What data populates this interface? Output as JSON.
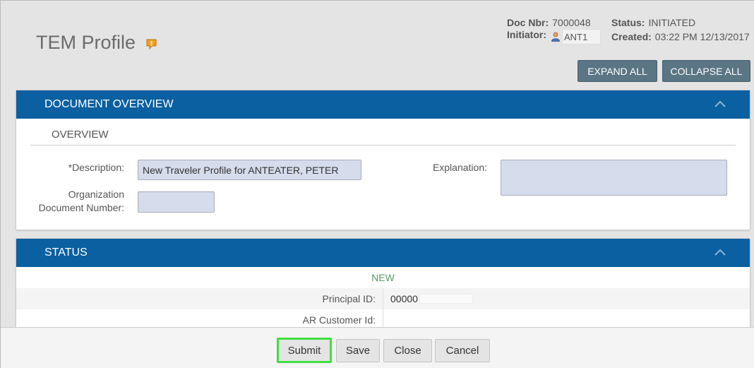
{
  "header": {
    "title": "TEM Profile",
    "doc_nbr_label": "Doc Nbr:",
    "doc_nbr": "7000048",
    "status_label": "Status:",
    "status": "INITIATED",
    "initiator_label": "Initiator:",
    "initiator": "ANT1",
    "created_label": "Created:",
    "created": "03:22 PM 12/13/2017"
  },
  "toolbar": {
    "expand_all": "EXPAND ALL",
    "collapse_all": "COLLAPSE ALL"
  },
  "document_overview": {
    "title": "DOCUMENT OVERVIEW",
    "subtitle": "OVERVIEW",
    "description_label": "*Description:",
    "description_value": "New Traveler Profile for  ANTEATER,  PETER",
    "explanation_label": "Explanation:",
    "explanation_value": "",
    "org_doc_label_line1": "Organization",
    "org_doc_label_line2": "Document Number:",
    "org_doc_value": ""
  },
  "status_section": {
    "title": "STATUS",
    "state": "NEW",
    "principal_id_label": "Principal ID:",
    "principal_id_value": "00000",
    "ar_customer_label": "AR Customer Id:",
    "ar_customer_value": ""
  },
  "footer": {
    "submit": "Submit",
    "save": "Save",
    "close": "Close",
    "cancel": "Cancel"
  },
  "colors": {
    "panel_header": "#0a60a0",
    "top_button": "#5a7584",
    "submit_highlight": "#3ee03e",
    "input_bg": "#d5dcec"
  }
}
